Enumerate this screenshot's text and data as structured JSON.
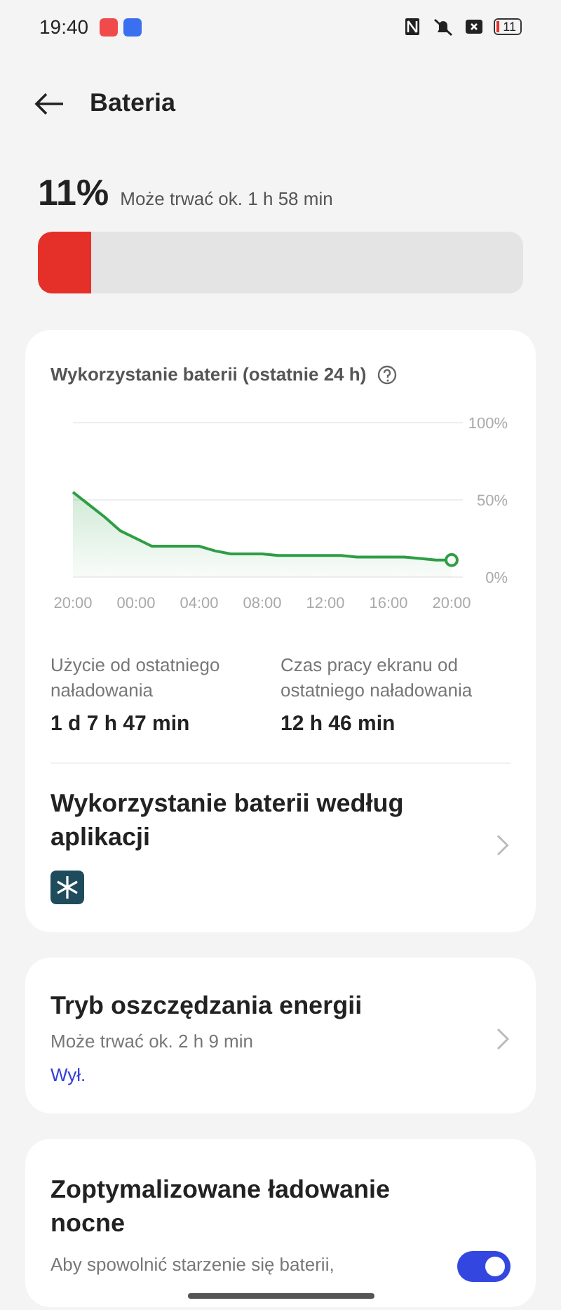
{
  "status_bar": {
    "time": "19:40",
    "battery_text": "11"
  },
  "header": {
    "title": "Bateria"
  },
  "battery": {
    "percent": "11%",
    "estimate": "Może trwać ok. 1 h 58 min",
    "level": 0.11
  },
  "usage_card": {
    "chart_title": "Wykorzystanie baterii (ostatnie 24 h)",
    "chart_data": {
      "type": "area",
      "categories": [
        "20:00",
        null,
        null,
        null,
        "00:00",
        null,
        null,
        null,
        "04:00",
        null,
        null,
        null,
        "08:00",
        null,
        null,
        null,
        "12:00",
        null,
        null,
        null,
        "16:00",
        null,
        null,
        null,
        "20:00"
      ],
      "series": [
        {
          "color": "#2e9e44",
          "values": [
            55,
            47,
            39,
            30,
            25,
            20,
            20,
            20,
            20,
            17,
            15,
            15,
            15,
            14,
            14,
            14,
            14,
            14,
            13,
            13,
            13,
            13,
            12,
            11,
            11
          ]
        }
      ],
      "ylim": [
        0,
        100
      ],
      "yticks": [
        {
          "value": 0,
          "label": "0%"
        },
        {
          "value": 50,
          "label": "50%"
        },
        {
          "value": 100,
          "label": "100%"
        }
      ]
    },
    "stats": [
      {
        "label": "Użycie od ostatniego naładowania",
        "value": "1 d 7 h 47 min"
      },
      {
        "label": "Czas pracy ekranu od ostatniego naładowania",
        "value": "12 h 46 min"
      }
    ],
    "apps_title": "Wykorzystanie baterii według aplikacji"
  },
  "saver_card": {
    "title": "Tryb oszczędzania energii",
    "subtitle": "Może trwać ok. 2 h 9 min",
    "state": "Wył."
  },
  "night_card": {
    "title": "Zoptymalizowane ładowanie nocne",
    "description": "Aby spowolnić starzenie się baterii,",
    "on": true
  }
}
